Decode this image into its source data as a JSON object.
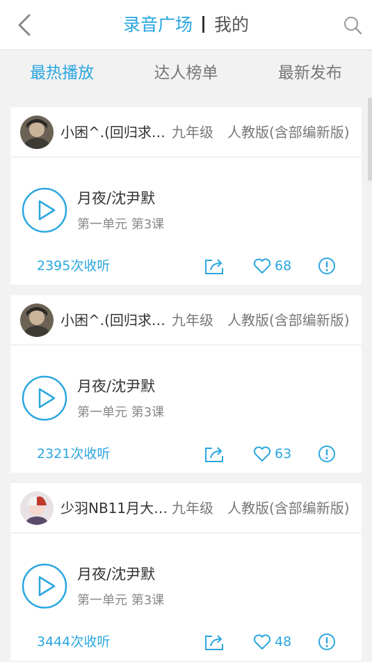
{
  "header": {
    "title_active": "录音广场",
    "title_other": "我的"
  },
  "tabs": [
    "最热播放",
    "达人榜单",
    "最新发布"
  ],
  "theme": {
    "accent": "#2aa6e0"
  },
  "cards": [
    {
      "user": "小困^.(回归求赞…",
      "grade": "九年级　人教版(含部编新版)",
      "title": "月夜/沈尹默",
      "sub": "第一单元  第3课",
      "listens": "2395次收听",
      "likes": "68"
    },
    {
      "user": "小困^.(回归求赞…",
      "grade": "九年级　人教版(含部编新版)",
      "title": "月夜/沈尹默",
      "sub": "第一单元  第3课",
      "listens": "2321次收听",
      "likes": "63"
    },
    {
      "user": "少羽NB11月大…",
      "grade": "九年级　人教版(含部编新版)",
      "title": "月夜/沈尹默",
      "sub": "第一单元  第3课",
      "listens": "3444次收听",
      "likes": "48"
    }
  ]
}
